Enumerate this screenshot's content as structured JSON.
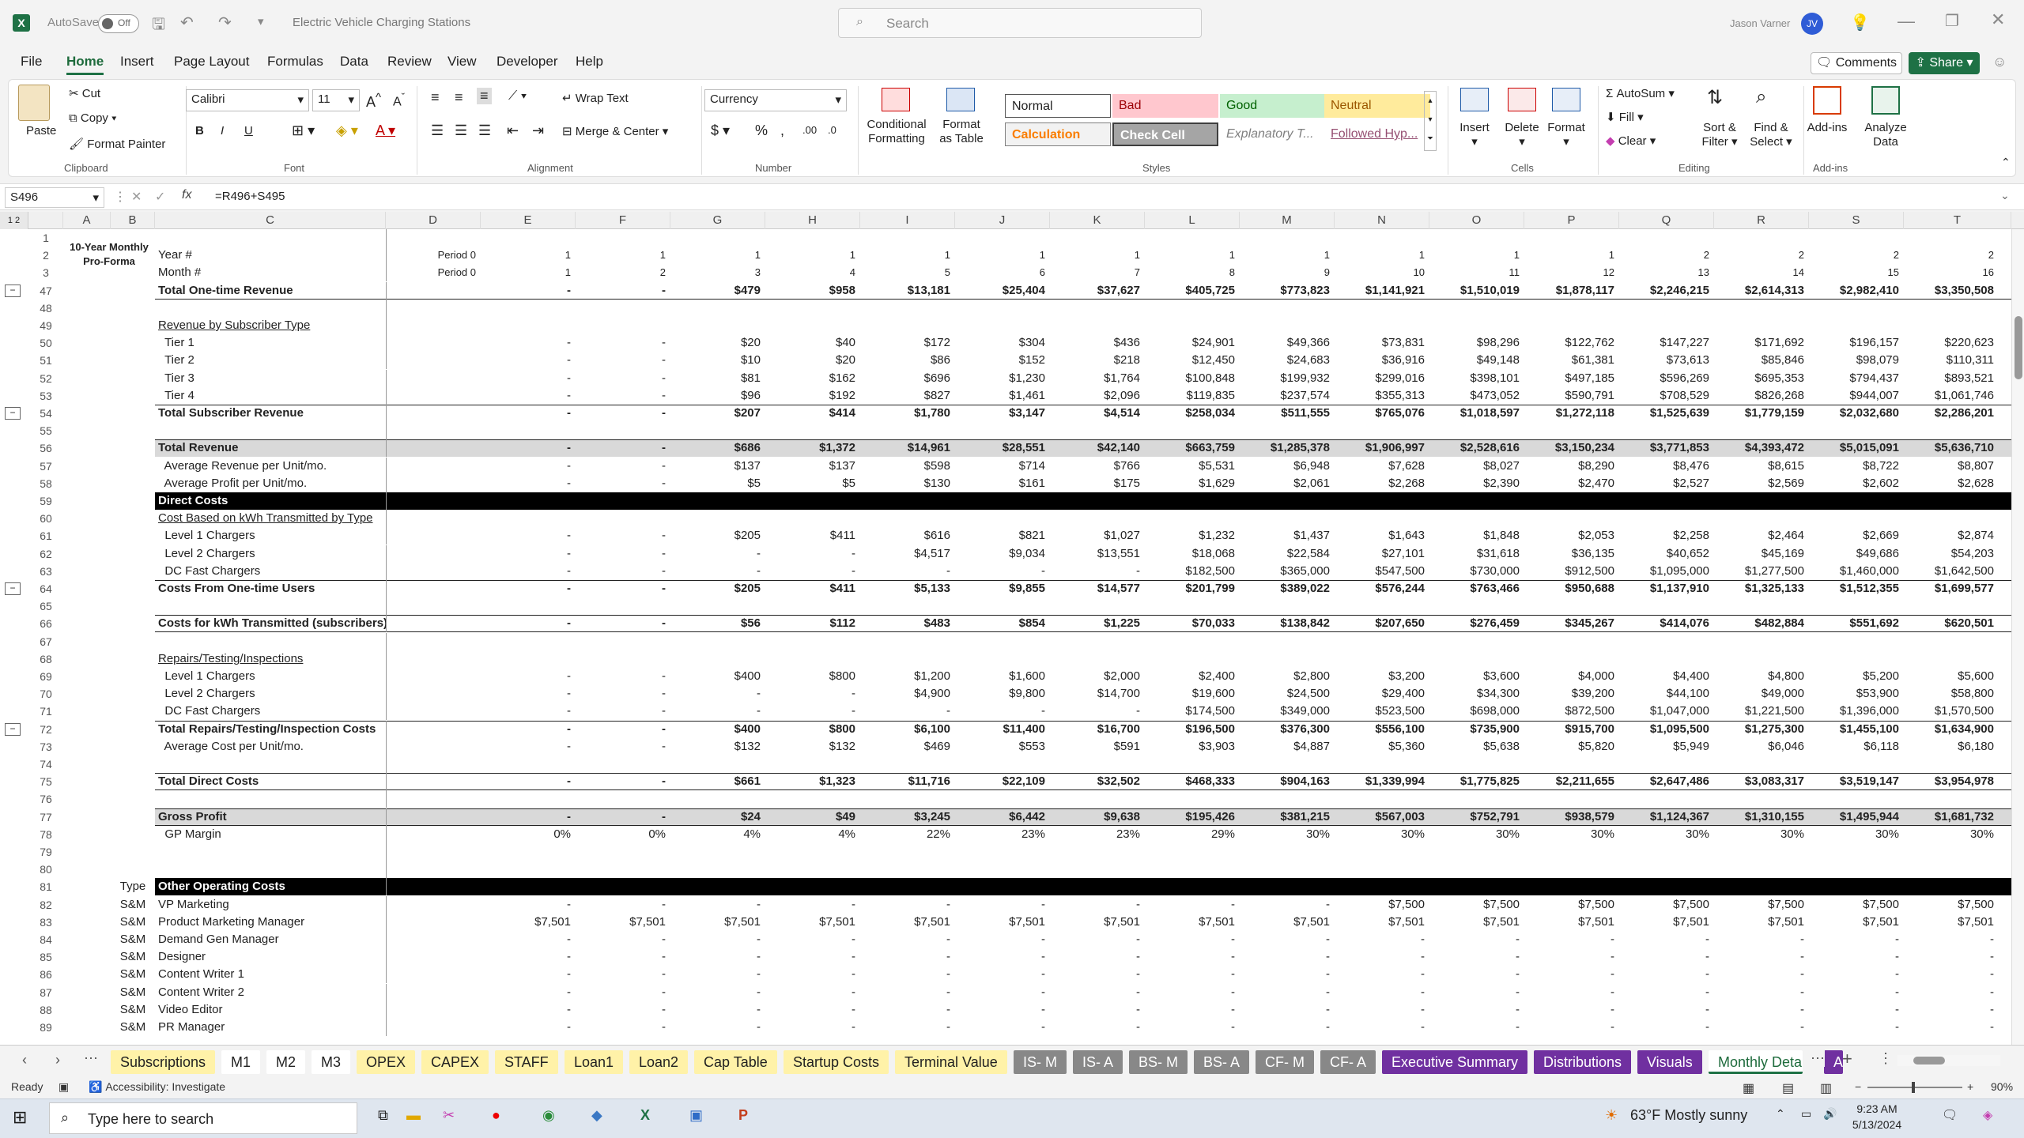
{
  "titlebar": {
    "autosave_label": "AutoSave",
    "autosave_state": "Off",
    "doc_title": "Electric Vehicle Charging Stations",
    "search_placeholder": "Search",
    "user_name": "Jason Varner",
    "user_initials": "JV"
  },
  "menu": [
    "File",
    "Home",
    "Insert",
    "Page Layout",
    "Formulas",
    "Data",
    "Review",
    "View",
    "Developer",
    "Help"
  ],
  "menu_right": {
    "comments": "Comments",
    "share": "Share"
  },
  "ribbon": {
    "clipboard": {
      "paste": "Paste",
      "cut": "Cut",
      "copy": "Copy",
      "format_painter": "Format Painter",
      "group": "Clipboard"
    },
    "font": {
      "name": "Calibri",
      "size": "11",
      "group": "Font",
      "bold": "B",
      "italic": "I",
      "underline": "U"
    },
    "alignment": {
      "wrap": "Wrap Text",
      "merge": "Merge & Center",
      "group": "Alignment"
    },
    "number": {
      "format": "Currency",
      "group": "Number",
      "dollar": "$",
      "percent": "%",
      "comma": ","
    },
    "styles": {
      "conditional": "Conditional Formatting",
      "format_table": "Format as Table",
      "group": "Styles",
      "normal": "Normal",
      "bad": "Bad",
      "good": "Good",
      "neutral": "Neutral",
      "calculation": "Calculation",
      "check_cell": "Check Cell",
      "explanatory": "Explanatory T...",
      "followed": "Followed Hyp..."
    },
    "cells": {
      "insert": "Insert",
      "delete": "Delete",
      "format": "Format",
      "group": "Cells"
    },
    "editing": {
      "autosum": "AutoSum",
      "fill": "Fill",
      "clear": "Clear",
      "sort": "Sort & Filter",
      "find": "Find & Select",
      "group": "Editing"
    },
    "addins": {
      "addins": "Add-ins",
      "analyze": "Analyze Data",
      "group": "Add-ins"
    }
  },
  "formula": {
    "namebox": "S496",
    "fx": "fx",
    "formula": "=R496+S495"
  },
  "columns": [
    "A",
    "B",
    "C",
    "D",
    "E",
    "F",
    "G",
    "H",
    "I",
    "J",
    "K",
    "L",
    "M",
    "N",
    "O",
    "P",
    "Q",
    "R",
    "S",
    "T"
  ],
  "header_block": {
    "title1": "10-Year Monthly",
    "title2": "Pro-Forma"
  },
  "rows": [
    {
      "n": "1",
      "c": "",
      "d": "",
      "v": []
    },
    {
      "n": "2",
      "c": "Year #",
      "d": "Period 0",
      "v": [
        "1",
        "1",
        "1",
        "1",
        "1",
        "1",
        "1",
        "1",
        "1",
        "1",
        "1",
        "1",
        "2",
        "2",
        "2",
        "2"
      ]
    },
    {
      "n": "3",
      "c": "Month #",
      "d": "Period 0",
      "v": [
        "1",
        "2",
        "3",
        "4",
        "5",
        "6",
        "7",
        "8",
        "9",
        "10",
        "11",
        "12",
        "13",
        "14",
        "15",
        "16"
      ]
    },
    {
      "n": "47",
      "c": "Total One-time Revenue",
      "d": "",
      "v": [
        "-",
        "-",
        "$479",
        "$958",
        "$13,181",
        "$25,404",
        "$37,627",
        "$405,725",
        "$773,823",
        "$1,141,921",
        "$1,510,019",
        "$1,878,117",
        "$2,246,215",
        "$2,614,313",
        "$2,982,410",
        "$3,350,508"
      ],
      "style": "bold bbot"
    },
    {
      "n": "48",
      "c": "",
      "d": "",
      "v": []
    },
    {
      "n": "49",
      "c": "Revenue by Subscriber Type",
      "d": "",
      "v": [],
      "style": "ul"
    },
    {
      "n": "50",
      "c": "  Tier 1",
      "d": "",
      "v": [
        "-",
        "-",
        "$20",
        "$40",
        "$172",
        "$304",
        "$436",
        "$24,901",
        "$49,366",
        "$73,831",
        "$98,296",
        "$122,762",
        "$147,227",
        "$171,692",
        "$196,157",
        "$220,623"
      ]
    },
    {
      "n": "51",
      "c": "  Tier 2",
      "d": "",
      "v": [
        "-",
        "-",
        "$10",
        "$20",
        "$86",
        "$152",
        "$218",
        "$12,450",
        "$24,683",
        "$36,916",
        "$49,148",
        "$61,381",
        "$73,613",
        "$85,846",
        "$98,079",
        "$110,311"
      ]
    },
    {
      "n": "52",
      "c": "  Tier 3",
      "d": "",
      "v": [
        "-",
        "-",
        "$81",
        "$162",
        "$696",
        "$1,230",
        "$1,764",
        "$100,848",
        "$199,932",
        "$299,016",
        "$398,101",
        "$497,185",
        "$596,269",
        "$695,353",
        "$794,437",
        "$893,521"
      ]
    },
    {
      "n": "53",
      "c": "  Tier 4",
      "d": "",
      "v": [
        "-",
        "-",
        "$96",
        "$192",
        "$827",
        "$1,461",
        "$2,096",
        "$119,835",
        "$237,574",
        "$355,313",
        "$473,052",
        "$590,791",
        "$708,529",
        "$826,268",
        "$944,007",
        "$1,061,746"
      ]
    },
    {
      "n": "54",
      "c": "Total Subscriber Revenue",
      "d": "",
      "v": [
        "-",
        "-",
        "$207",
        "$414",
        "$1,780",
        "$3,147",
        "$4,514",
        "$258,034",
        "$511,555",
        "$765,076",
        "$1,018,597",
        "$1,272,118",
        "$1,525,639",
        "$1,779,159",
        "$2,032,680",
        "$2,286,201"
      ],
      "style": "bold btop"
    },
    {
      "n": "55",
      "c": "",
      "d": "",
      "v": []
    },
    {
      "n": "56",
      "c": "Total Revenue",
      "d": "",
      "v": [
        "-",
        "-",
        "$686",
        "$1,372",
        "$14,961",
        "$28,551",
        "$42,140",
        "$663,759",
        "$1,285,378",
        "$1,906,997",
        "$2,528,616",
        "$3,150,234",
        "$3,771,853",
        "$4,393,472",
        "$5,015,091",
        "$5,636,710"
      ],
      "style": "bold gray btop"
    },
    {
      "n": "57",
      "c": "  Average Revenue per Unit/mo.",
      "d": "",
      "v": [
        "-",
        "-",
        "$137",
        "$137",
        "$598",
        "$714",
        "$766",
        "$5,531",
        "$6,948",
        "$7,628",
        "$8,027",
        "$8,290",
        "$8,476",
        "$8,615",
        "$8,722",
        "$8,807"
      ]
    },
    {
      "n": "58",
      "c": "  Average Profit per Unit/mo.",
      "d": "",
      "v": [
        "-",
        "-",
        "$5",
        "$5",
        "$130",
        "$161",
        "$175",
        "$1,629",
        "$2,061",
        "$2,268",
        "$2,390",
        "$2,470",
        "$2,527",
        "$2,569",
        "$2,602",
        "$2,628"
      ]
    },
    {
      "n": "59",
      "c": "Direct Costs",
      "d": "",
      "v": [],
      "style": "black"
    },
    {
      "n": "60",
      "c": "Cost Based on kWh Transmitted by Type",
      "d": "",
      "v": [],
      "style": "ul"
    },
    {
      "n": "61",
      "c": "  Level 1 Chargers",
      "d": "",
      "v": [
        "-",
        "-",
        "$205",
        "$411",
        "$616",
        "$821",
        "$1,027",
        "$1,232",
        "$1,437",
        "$1,643",
        "$1,848",
        "$2,053",
        "$2,258",
        "$2,464",
        "$2,669",
        "$2,874"
      ]
    },
    {
      "n": "62",
      "c": "  Level 2 Chargers",
      "d": "",
      "v": [
        "-",
        "-",
        "-",
        "-",
        "$4,517",
        "$9,034",
        "$13,551",
        "$18,068",
        "$22,584",
        "$27,101",
        "$31,618",
        "$36,135",
        "$40,652",
        "$45,169",
        "$49,686",
        "$54,203"
      ]
    },
    {
      "n": "63",
      "c": "  DC Fast Chargers",
      "d": "",
      "v": [
        "-",
        "-",
        "-",
        "-",
        "-",
        "-",
        "-",
        "$182,500",
        "$365,000",
        "$547,500",
        "$730,000",
        "$912,500",
        "$1,095,000",
        "$1,277,500",
        "$1,460,000",
        "$1,642,500"
      ]
    },
    {
      "n": "64",
      "c": "Costs From One-time Users",
      "d": "",
      "v": [
        "-",
        "-",
        "$205",
        "$411",
        "$5,133",
        "$9,855",
        "$14,577",
        "$201,799",
        "$389,022",
        "$576,244",
        "$763,466",
        "$950,688",
        "$1,137,910",
        "$1,325,133",
        "$1,512,355",
        "$1,699,577"
      ],
      "style": "bold btop"
    },
    {
      "n": "65",
      "c": "",
      "d": "",
      "v": []
    },
    {
      "n": "66",
      "c": "Costs for kWh Transmitted (subscribers)",
      "d": "",
      "v": [
        "-",
        "-",
        "$56",
        "$112",
        "$483",
        "$854",
        "$1,225",
        "$70,033",
        "$138,842",
        "$207,650",
        "$276,459",
        "$345,267",
        "$414,076",
        "$482,884",
        "$551,692",
        "$620,501"
      ],
      "style": "bold btop bbot"
    },
    {
      "n": "67",
      "c": "",
      "d": "",
      "v": []
    },
    {
      "n": "68",
      "c": "Repairs/Testing/Inspections",
      "d": "",
      "v": [],
      "style": "ul"
    },
    {
      "n": "69",
      "c": "  Level 1 Chargers",
      "d": "",
      "v": [
        "-",
        "-",
        "$400",
        "$800",
        "$1,200",
        "$1,600",
        "$2,000",
        "$2,400",
        "$2,800",
        "$3,200",
        "$3,600",
        "$4,000",
        "$4,400",
        "$4,800",
        "$5,200",
        "$5,600"
      ]
    },
    {
      "n": "70",
      "c": "  Level 2 Chargers",
      "d": "",
      "v": [
        "-",
        "-",
        "-",
        "-",
        "$4,900",
        "$9,800",
        "$14,700",
        "$19,600",
        "$24,500",
        "$29,400",
        "$34,300",
        "$39,200",
        "$44,100",
        "$49,000",
        "$53,900",
        "$58,800"
      ]
    },
    {
      "n": "71",
      "c": "  DC Fast Chargers",
      "d": "",
      "v": [
        "-",
        "-",
        "-",
        "-",
        "-",
        "-",
        "-",
        "$174,500",
        "$349,000",
        "$523,500",
        "$698,000",
        "$872,500",
        "$1,047,000",
        "$1,221,500",
        "$1,396,000",
        "$1,570,500"
      ]
    },
    {
      "n": "72",
      "c": "Total Repairs/Testing/Inspection Costs",
      "d": "",
      "v": [
        "-",
        "-",
        "$400",
        "$800",
        "$6,100",
        "$11,400",
        "$16,700",
        "$196,500",
        "$376,300",
        "$556,100",
        "$735,900",
        "$915,700",
        "$1,095,500",
        "$1,275,300",
        "$1,455,100",
        "$1,634,900"
      ],
      "style": "bold btop"
    },
    {
      "n": "73",
      "c": "  Average Cost per Unit/mo.",
      "d": "",
      "v": [
        "-",
        "-",
        "$132",
        "$132",
        "$469",
        "$553",
        "$591",
        "$3,903",
        "$4,887",
        "$5,360",
        "$5,638",
        "$5,820",
        "$5,949",
        "$6,046",
        "$6,118",
        "$6,180"
      ]
    },
    {
      "n": "74",
      "c": "",
      "d": "",
      "v": []
    },
    {
      "n": "75",
      "c": "Total Direct Costs",
      "d": "",
      "v": [
        "-",
        "-",
        "$661",
        "$1,323",
        "$11,716",
        "$22,109",
        "$32,502",
        "$468,333",
        "$904,163",
        "$1,339,994",
        "$1,775,825",
        "$2,211,655",
        "$2,647,486",
        "$3,083,317",
        "$3,519,147",
        "$3,954,978"
      ],
      "style": "bold btop bbot"
    },
    {
      "n": "76",
      "c": "",
      "d": "",
      "v": []
    },
    {
      "n": "77",
      "c": "Gross Profit",
      "d": "",
      "v": [
        "-",
        "-",
        "$24",
        "$49",
        "$3,245",
        "$6,442",
        "$9,638",
        "$195,426",
        "$381,215",
        "$567,003",
        "$752,791",
        "$938,579",
        "$1,124,367",
        "$1,310,155",
        "$1,495,944",
        "$1,681,732"
      ],
      "style": "bold gray btop bbot"
    },
    {
      "n": "78",
      "c": "  GP Margin",
      "d": "",
      "v": [
        "0%",
        "0%",
        "4%",
        "4%",
        "22%",
        "23%",
        "23%",
        "29%",
        "30%",
        "30%",
        "30%",
        "30%",
        "30%",
        "30%",
        "30%",
        "30%"
      ]
    },
    {
      "n": "79",
      "c": "",
      "d": "",
      "v": []
    },
    {
      "n": "80",
      "c": "",
      "d": "",
      "v": []
    },
    {
      "n": "81",
      "b": "Type",
      "c": "Other Operating Costs",
      "d": "",
      "v": [],
      "style": "black"
    },
    {
      "n": "82",
      "b": "S&M",
      "c": "VP Marketing",
      "d": "",
      "v": [
        "-",
        "-",
        "-",
        "-",
        "-",
        "-",
        "-",
        "-",
        "-",
        "$7,500",
        "$7,500",
        "$7,500",
        "$7,500",
        "$7,500",
        "$7,500",
        "$7,500"
      ]
    },
    {
      "n": "83",
      "b": "S&M",
      "c": "Product Marketing Manager",
      "d": "",
      "v": [
        "$7,501",
        "$7,501",
        "$7,501",
        "$7,501",
        "$7,501",
        "$7,501",
        "$7,501",
        "$7,501",
        "$7,501",
        "$7,501",
        "$7,501",
        "$7,501",
        "$7,501",
        "$7,501",
        "$7,501",
        "$7,501"
      ]
    },
    {
      "n": "84",
      "b": "S&M",
      "c": "Demand Gen Manager",
      "d": "",
      "v": [
        "-",
        "-",
        "-",
        "-",
        "-",
        "-",
        "-",
        "-",
        "-",
        "-",
        "-",
        "-",
        "-",
        "-",
        "-",
        "-"
      ]
    },
    {
      "n": "85",
      "b": "S&M",
      "c": "Designer",
      "d": "",
      "v": [
        "-",
        "-",
        "-",
        "-",
        "-",
        "-",
        "-",
        "-",
        "-",
        "-",
        "-",
        "-",
        "-",
        "-",
        "-",
        "-"
      ]
    },
    {
      "n": "86",
      "b": "S&M",
      "c": "Content Writer 1",
      "d": "",
      "v": [
        "-",
        "-",
        "-",
        "-",
        "-",
        "-",
        "-",
        "-",
        "-",
        "-",
        "-",
        "-",
        "-",
        "-",
        "-",
        "-"
      ]
    },
    {
      "n": "87",
      "b": "S&M",
      "c": "Content Writer 2",
      "d": "",
      "v": [
        "-",
        "-",
        "-",
        "-",
        "-",
        "-",
        "-",
        "-",
        "-",
        "-",
        "-",
        "-",
        "-",
        "-",
        "-",
        "-"
      ]
    },
    {
      "n": "88",
      "b": "S&M",
      "c": "Video Editor",
      "d": "",
      "v": [
        "-",
        "-",
        "-",
        "-",
        "-",
        "-",
        "-",
        "-",
        "-",
        "-",
        "-",
        "-",
        "-",
        "-",
        "-",
        "-"
      ]
    },
    {
      "n": "89",
      "b": "S&M",
      "c": "PR Manager",
      "d": "",
      "v": [
        "-",
        "-",
        "-",
        "-",
        "-",
        "-",
        "-",
        "-",
        "-",
        "-",
        "-",
        "-",
        "-",
        "-",
        "-",
        "-"
      ]
    }
  ],
  "sheet_tabs": [
    {
      "label": "Subscriptions",
      "kind": "yel"
    },
    {
      "label": "M1",
      "kind": "wht"
    },
    {
      "label": "M2",
      "kind": "wht"
    },
    {
      "label": "M3",
      "kind": "wht"
    },
    {
      "label": "OPEX",
      "kind": "yel"
    },
    {
      "label": "CAPEX",
      "kind": "yel"
    },
    {
      "label": "STAFF",
      "kind": "yel"
    },
    {
      "label": "Loan1",
      "kind": "yel"
    },
    {
      "label": "Loan2",
      "kind": "yel"
    },
    {
      "label": "Cap Table",
      "kind": "yel"
    },
    {
      "label": "Startup Costs",
      "kind": "yel"
    },
    {
      "label": "Terminal Value",
      "kind": "yel"
    },
    {
      "label": "IS- M",
      "kind": "gry"
    },
    {
      "label": "IS- A",
      "kind": "gry"
    },
    {
      "label": "BS- M",
      "kind": "gry"
    },
    {
      "label": "BS- A",
      "kind": "gry"
    },
    {
      "label": "CF- M",
      "kind": "gry"
    },
    {
      "label": "CF- A",
      "kind": "gry"
    },
    {
      "label": "Executive Summary",
      "kind": "pur"
    },
    {
      "label": "Distributions",
      "kind": "pur"
    },
    {
      "label": "Visuals",
      "kind": "pur"
    },
    {
      "label": "Monthly Detail",
      "kind": "act"
    },
    {
      "label": "Ann",
      "kind": "pur"
    }
  ],
  "status": {
    "ready": "Ready",
    "accessibility": "Accessibility: Investigate",
    "zoom": "90%"
  },
  "taskbar": {
    "search": "Type here to search",
    "weather": "63°F  Mostly sunny",
    "time": "9:23 AM",
    "date": "5/13/2024"
  }
}
